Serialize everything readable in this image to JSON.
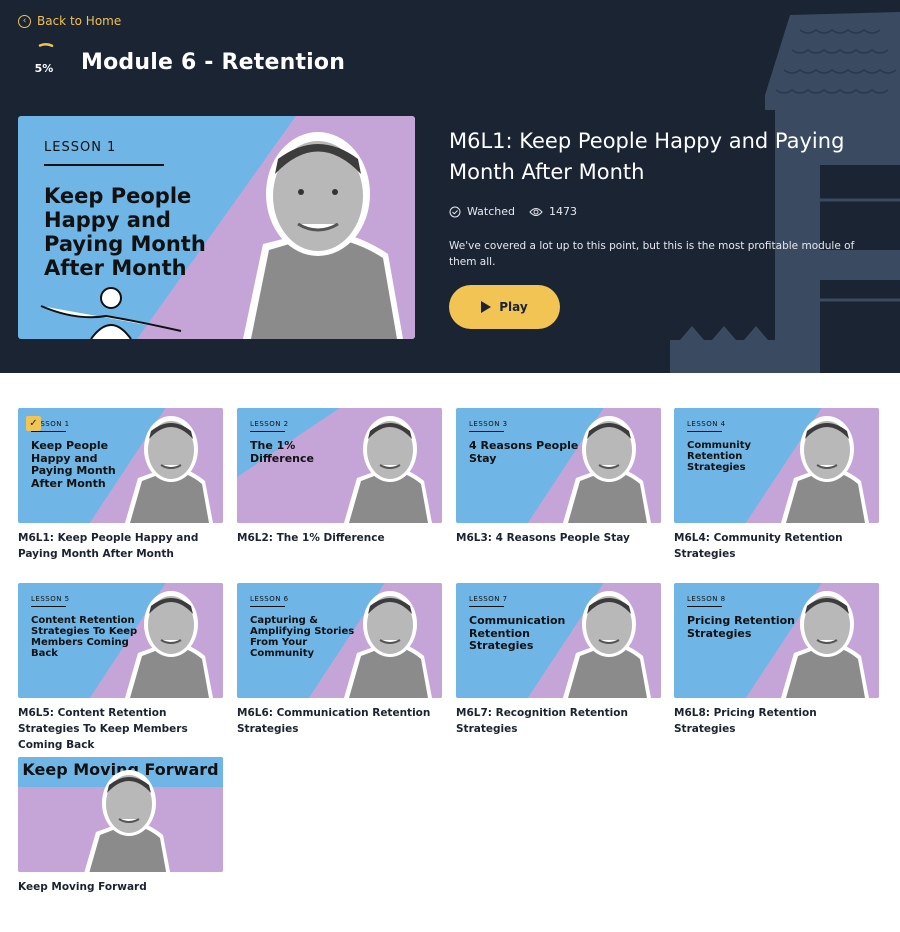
{
  "header": {
    "back_label": "Back to Home",
    "progress_text": "5%",
    "progress_value": 0.05,
    "module_title": "Module 6 - Retention"
  },
  "featured": {
    "thumb_tag": "LESSON 1",
    "thumb_title": "Keep People Happy and Paying Month After Month",
    "title": "M6L1: Keep People Happy and Paying Month After Month",
    "status": "Watched",
    "views": "1473",
    "description": "We've covered a lot up to this point, but this is the most profitable module of them all.",
    "play_label": "Play"
  },
  "colors": {
    "navy": "#1a2433",
    "accent": "#f1c453",
    "sky": "#6fb6e6",
    "lavender": "#c5a5d8"
  },
  "lessons": [
    {
      "tag": "LESSON 1",
      "thumb_title": "Keep People Happy and Paying Month After Month",
      "caption": "M6L1: Keep People Happy and Paying Month After Month",
      "watched": true
    },
    {
      "tag": "LESSON 2",
      "thumb_title": "The 1% Difference",
      "caption": "M6L2: The 1% Difference",
      "watched": false
    },
    {
      "tag": "LESSON 3",
      "thumb_title": "4 Reasons People Stay",
      "caption": "M6L3: 4 Reasons People Stay",
      "watched": false
    },
    {
      "tag": "LESSON 4",
      "thumb_title": "Community Retention Strategies",
      "caption": "M6L4: Community Retention Strategies",
      "watched": false
    },
    {
      "tag": "LESSON 5",
      "thumb_title": "Content Retention Strategies To Keep Members Coming Back",
      "caption": "M6L5: Content Retention Strategies To Keep Members Coming Back",
      "watched": false
    },
    {
      "tag": "LESSON 6",
      "thumb_title": "Capturing & Amplifying Stories From Your Community",
      "caption": "M6L6: Communication Retention Strategies",
      "watched": false
    },
    {
      "tag": "LESSON 7",
      "thumb_title": "Communication Retention Strategies",
      "caption": "M6L7: Recognition Retention Strategies",
      "watched": false
    },
    {
      "tag": "LESSON 8",
      "thumb_title": "Pricing Retention Strategies",
      "caption": "M6L8: Pricing Retention Strategies",
      "watched": false
    },
    {
      "tag": "",
      "thumb_title": "Keep Moving Forward",
      "caption": "Keep Moving Forward",
      "watched": false
    }
  ]
}
